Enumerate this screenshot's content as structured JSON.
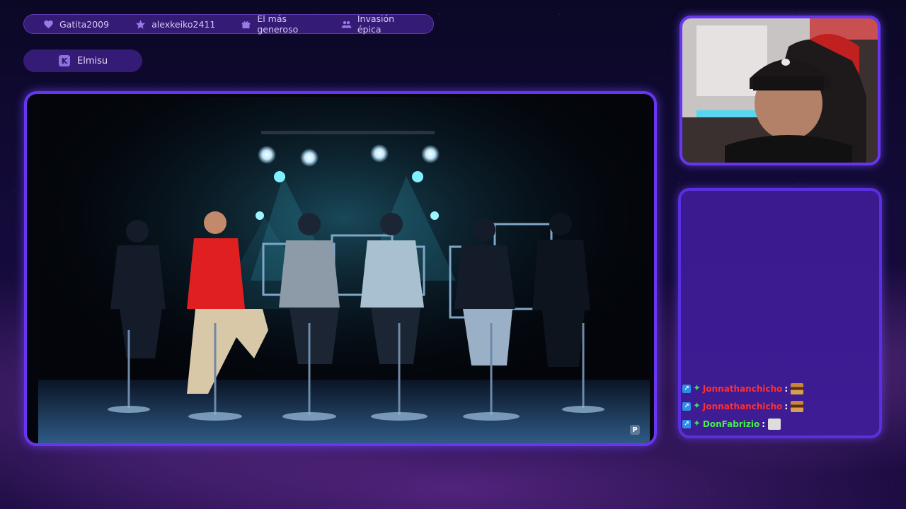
{
  "alerts_bar": {
    "items": [
      {
        "icon": "heart-icon",
        "label": "Gatita2009"
      },
      {
        "icon": "star-icon",
        "label": "alexkeiko2411"
      },
      {
        "icon": "gift-icon",
        "label": "El más generoso"
      },
      {
        "icon": "group-icon",
        "label": "Invasión épica"
      }
    ]
  },
  "streamer": {
    "platform_badge": "K",
    "name": "Elmisu"
  },
  "video": {
    "watermark": "P"
  },
  "chat": {
    "messages": [
      {
        "user": "Jonnathanchicho",
        "color": "#ff3030",
        "emote": "burger-emote"
      },
      {
        "user": "Jonnathanchicho",
        "color": "#ff3030",
        "emote": "burger-emote"
      },
      {
        "user": "DonFabrizio",
        "color": "#4af04a",
        "emote": "cat-emote"
      }
    ]
  },
  "colors": {
    "frame_accent": "#6a35f0",
    "panel_bg": "#3a1a8e"
  }
}
